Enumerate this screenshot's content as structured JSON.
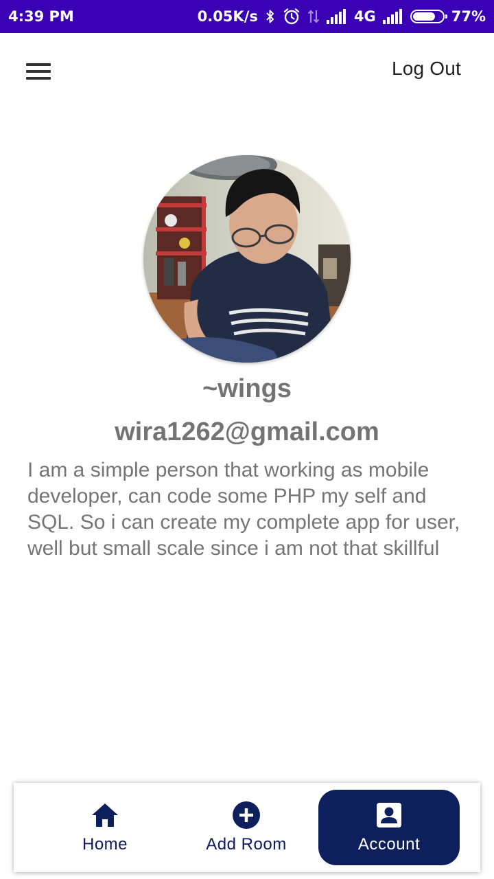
{
  "status_bar": {
    "time": "4:39 PM",
    "network_speed": "0.05K/s",
    "network_type": "4G",
    "battery_percent": "77%",
    "battery_level": 0.77,
    "icons": [
      "bluetooth-icon",
      "alarm-icon",
      "data-arrows-icon",
      "signal-icon",
      "signal-icon",
      "battery-icon"
    ]
  },
  "app_bar": {
    "menu_icon": "hamburger-menu-icon",
    "logout_label": "Log Out"
  },
  "profile": {
    "avatar": "profile-photo",
    "username": "~wings",
    "email": "wira1262@gmail.com",
    "bio": "I am a simple person that working as mobile developer, can code some PHP my self and SQL. So i can create my complete app for user, well but small scale since i am not that skillful"
  },
  "bottom_nav": {
    "items": [
      {
        "label": "Home",
        "icon": "home-icon",
        "selected": false
      },
      {
        "label": "Add Room",
        "icon": "add-circle-icon",
        "selected": false
      },
      {
        "label": "Account",
        "icon": "account-box-icon",
        "selected": true
      }
    ]
  },
  "colors": {
    "status_bar": "#3a00b4",
    "nav_accent": "#0d1f5c",
    "text_gray": "#737373"
  }
}
